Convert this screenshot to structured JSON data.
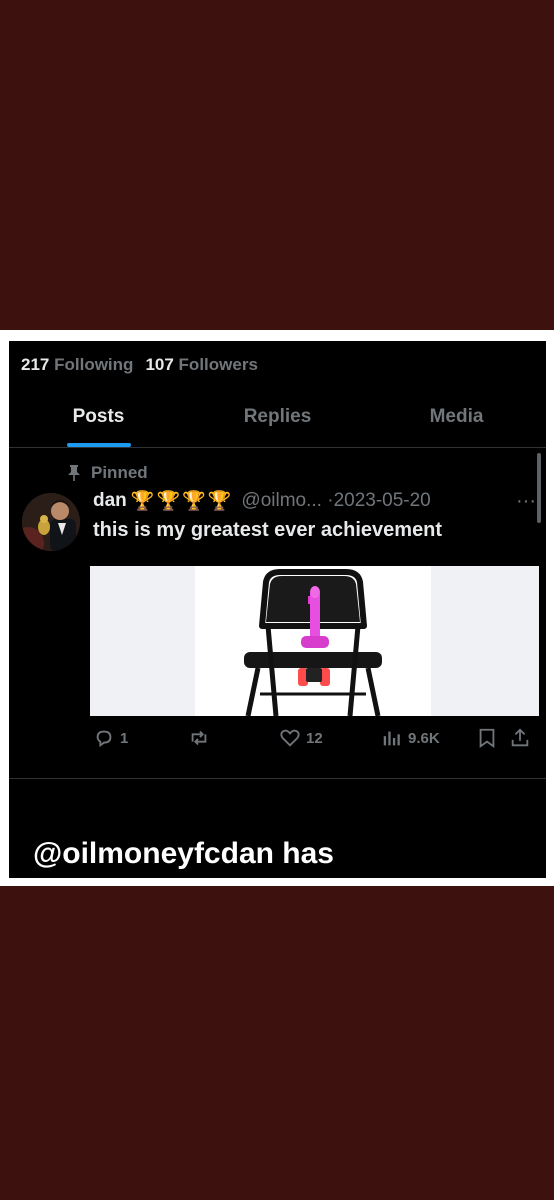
{
  "profile": {
    "following_count": "217",
    "following_label": "Following",
    "followers_count": "107",
    "followers_label": "Followers"
  },
  "tabs": [
    {
      "label": "Posts",
      "active": true
    },
    {
      "label": "Replies",
      "active": false
    },
    {
      "label": "Media",
      "active": false
    }
  ],
  "post": {
    "pinned_label": "Pinned",
    "author_name": "dan",
    "badges": "🏆🏆🏆🏆",
    "handle": "@oilmo...",
    "separator": "·",
    "date": "2023-05-20",
    "more": "···",
    "text": "this is my greatest ever achievement",
    "image_icon": "folding-chair-image",
    "actions": {
      "replies": "1",
      "reposts": "",
      "likes": "12",
      "views": "9.6K"
    }
  },
  "caption": "@oilmoneyfcdan has",
  "colors": {
    "background_band": "#3c110e",
    "accent": "#1d9bf0",
    "muted": "#71767b",
    "text": "#e7e9ea"
  }
}
